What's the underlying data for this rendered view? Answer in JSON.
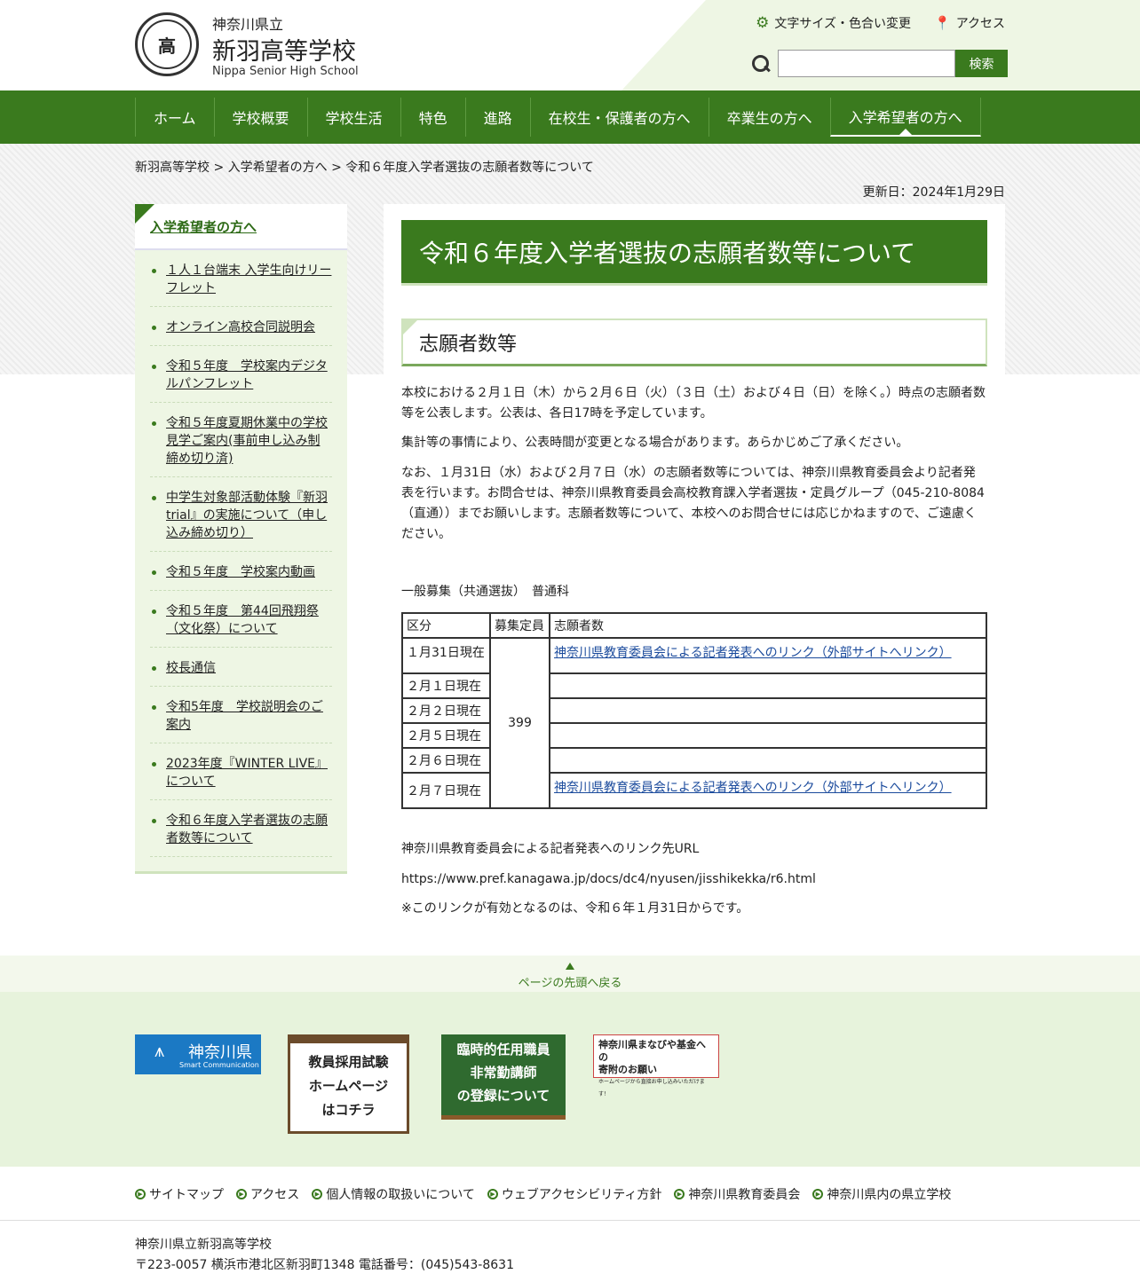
{
  "header": {
    "logo_glyph": "高",
    "pref": "神奈川県立",
    "school": "新羽高等学校",
    "school_en": "Nippa Senior High School",
    "util_text_size": "文字サイズ・色合い変更",
    "util_access": "アクセス",
    "search_button": "検索",
    "search_placeholder": ""
  },
  "nav": [
    "ホーム",
    "学校概要",
    "学校生活",
    "特色",
    "進路",
    "在校生・保護者の方へ",
    "卒業生の方へ",
    "入学希望者の方へ"
  ],
  "breadcrumb": "新羽高等学校 > 入学希望者の方へ > 令和６年度入学者選抜の志願者数等について",
  "updated": "更新日：2024年1月29日",
  "side": {
    "title": "入学希望者の方へ",
    "items": [
      "１人１台端末 入学生向けリーフレット",
      "オンライン高校合同説明会",
      "令和５年度　学校案内デジタルパンフレット",
      "令和５年度夏期休業中の学校見学ご案内(事前申し込み制 締め切り済)",
      "中学生対象部活動体験『新羽trial』の実施について（申し込み締め切り）",
      "令和５年度　学校案内動画",
      "令和５年度　第44回飛翔祭（文化祭）について",
      "校長通信",
      "令和5年度　学校説明会のご案内",
      "2023年度『WINTER LIVE』について",
      "令和６年度入学者選抜の志願者数等について"
    ]
  },
  "main": {
    "h1": "令和６年度入学者選抜の志願者数等について",
    "h2": "志願者数等",
    "p1": "本校における２月１日（木）から２月６日（火）（３日（土）および４日（日）を除く。）時点の志願者数等を公表します。公表は、各日17時を予定しています。",
    "p2": "集計等の事情により、公表時間が変更となる場合があります。あらかじめご了承ください。",
    "p3": "なお、１月31日（水）および２月７日（水）の志願者数等については、神奈川県教育委員会より記者発表を行います。お問合せは、神奈川県教育委員会高校教育課入学者選抜・定員グループ（045-210-8084（直通））までお願いします。志願者数等について、本校へのお問合せには応じかねますので、ご遠慮ください。",
    "table_caption": "一般募集（共通選抜）　普通科",
    "table_headers": [
      "区分",
      "募集定員",
      "志願者数"
    ],
    "capacity": "399",
    "link_text": "神奈川県教育委員会による記者発表へのリンク（外部サイトへリンク）",
    "rows": [
      "１月31日現在",
      "２月１日現在",
      "２月２日現在",
      "２月５日現在",
      "２月６日現在",
      "２月７日現在"
    ],
    "p4": "神奈川県教育委員会による記者発表へのリンク先URL",
    "p5": "https://www.pref.kanagawa.jp/docs/dc4/nyusen/jisshikekka/r6.html",
    "p6": "※このリンクが有効となるのは、令和６年１月31日からです。"
  },
  "totop": "ページの先頭へ戻る",
  "banners": {
    "b1_title": "神奈川県",
    "b1_sub": "Smart Communication",
    "b2_l1": "教員採用試験",
    "b2_l2": "ホームページ",
    "b2_l3": "はコチラ",
    "b3_l1": "臨時的任用職員",
    "b3_l2": "非常勤講師",
    "b3_l3": "の登録について",
    "b4_l1": "神奈川県まなびや基金への",
    "b4_l2": "寄附のお願い",
    "b4_l3": "ホームページから直接お申し込みいただけます！"
  },
  "footer_nav": [
    "サイトマップ",
    "アクセス",
    "個人情報の取扱いについて",
    "ウェブアクセシビリティ方針",
    "神奈川県教育委員会",
    "神奈川県内の県立学校"
  ],
  "footer_addr1": "神奈川県立新羽高等学校",
  "footer_addr2": "〒223-0057 横浜市港北区新羽町1348 電話番号：(045)543-8631"
}
